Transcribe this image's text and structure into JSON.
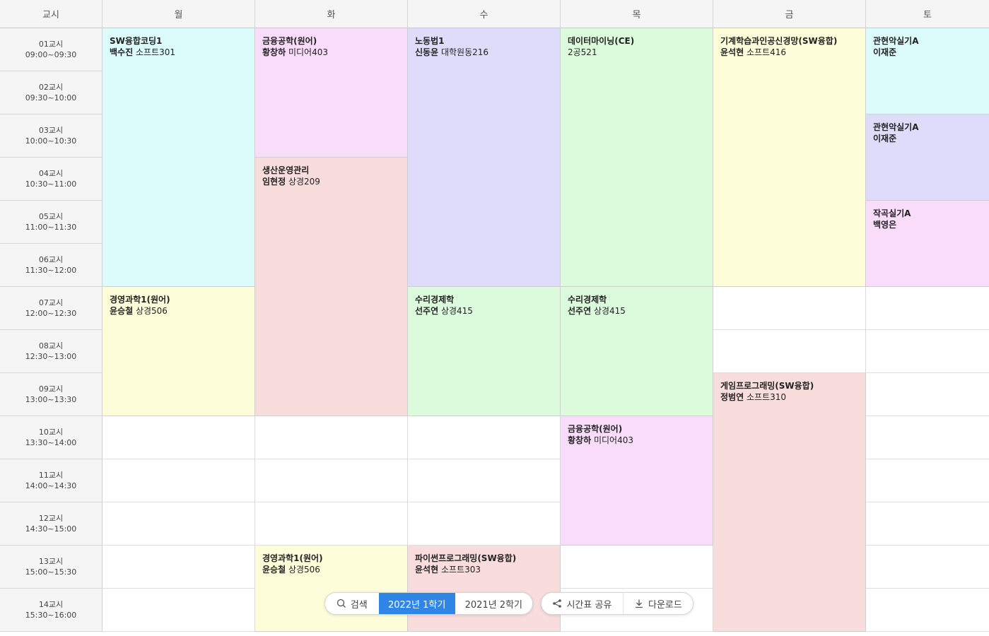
{
  "header": {
    "corner": "교시",
    "days": [
      "월",
      "화",
      "수",
      "목",
      "금",
      "토"
    ]
  },
  "periods": [
    {
      "label": "01교시",
      "time": "09:00~09:30"
    },
    {
      "label": "02교시",
      "time": "09:30~10:00"
    },
    {
      "label": "03교시",
      "time": "10:00~10:30"
    },
    {
      "label": "04교시",
      "time": "10:30~11:00"
    },
    {
      "label": "05교시",
      "time": "11:00~11:30"
    },
    {
      "label": "06교시",
      "time": "11:30~12:00"
    },
    {
      "label": "07교시",
      "time": "12:00~12:30"
    },
    {
      "label": "08교시",
      "time": "12:30~13:00"
    },
    {
      "label": "09교시",
      "time": "13:00~13:30"
    },
    {
      "label": "10교시",
      "time": "13:30~14:00"
    },
    {
      "label": "11교시",
      "time": "14:00~14:30"
    },
    {
      "label": "12교시",
      "time": "14:30~15:00"
    },
    {
      "label": "13교시",
      "time": "15:00~15:30"
    },
    {
      "label": "14교시",
      "time": "15:30~16:00"
    }
  ],
  "courses": [
    {
      "day": 0,
      "start": 1,
      "span": 6,
      "name": "SW융합코딩1",
      "professor": "백수진",
      "room": "소프트301",
      "color": "#dcfbfb"
    },
    {
      "day": 0,
      "start": 7,
      "span": 3,
      "name": "경영과학1(원어)",
      "professor": "윤승철",
      "room": "상경506",
      "color": "#fdfdd9"
    },
    {
      "day": 1,
      "start": 1,
      "span": 3,
      "name": "금융공학(원어)",
      "professor": "황창하",
      "room": "미디어403",
      "color": "#f8dcfa"
    },
    {
      "day": 1,
      "start": 4,
      "span": 6,
      "name": "생산운영관리",
      "professor": "임현정",
      "room": "상경209",
      "color": "#f9dcdc"
    },
    {
      "day": 1,
      "start": 13,
      "span": 2,
      "name": "경영과학1(원어)",
      "professor": "윤승철",
      "room": "상경506",
      "color": "#fdfdd9"
    },
    {
      "day": 2,
      "start": 1,
      "span": 6,
      "name": "노동법1",
      "professor": "신동윤",
      "room": "대학원동216",
      "color": "#dedcfa"
    },
    {
      "day": 2,
      "start": 7,
      "span": 3,
      "name": "수리경제학",
      "professor": "선주연",
      "room": "상경415",
      "color": "#dcfbdc"
    },
    {
      "day": 2,
      "start": 13,
      "span": 2,
      "name": "파이썬프로그래밍(SW융합)",
      "professor": "윤석현",
      "room": "소프트303",
      "color": "#f9dcdc"
    },
    {
      "day": 3,
      "start": 1,
      "span": 6,
      "name": "데이터마이닝(CE)",
      "professor": "",
      "room": "2공521",
      "color": "#dcfbdc"
    },
    {
      "day": 3,
      "start": 7,
      "span": 3,
      "name": "수리경제학",
      "professor": "선주연",
      "room": "상경415",
      "color": "#dcfbdc"
    },
    {
      "day": 3,
      "start": 10,
      "span": 3,
      "name": "금융공학(원어)",
      "professor": "황창하",
      "room": "미디어403",
      "color": "#f8dcfa"
    },
    {
      "day": 4,
      "start": 1,
      "span": 6,
      "name": "기계학습과인공신경망(SW융합)",
      "professor": "윤석현",
      "room": "소프트416",
      "color": "#fdfdd9"
    },
    {
      "day": 4,
      "start": 9,
      "span": 6,
      "name": "게임프로그래밍(SW융합)",
      "professor": "정범연",
      "room": "소프트310",
      "color": "#f9dcdc"
    },
    {
      "day": 5,
      "start": 1,
      "span": 2,
      "name": "관현악실기A",
      "professor": "이재준",
      "room": "",
      "color": "#dcfbfb"
    },
    {
      "day": 5,
      "start": 3,
      "span": 2,
      "name": "관현악실기A",
      "professor": "이재준",
      "room": "",
      "color": "#dedcfa"
    },
    {
      "day": 5,
      "start": 5,
      "span": 2,
      "name": "작곡실기A",
      "professor": "백영은",
      "room": "",
      "color": "#f8dcfa"
    }
  ],
  "toolbar": {
    "search_label": "검색",
    "semester_current": "2022년 1학기",
    "semester_previous": "2021년 2학기",
    "share_label": "시간표 공유",
    "download_label": "다운로드",
    "accent": "#2f86e6"
  }
}
